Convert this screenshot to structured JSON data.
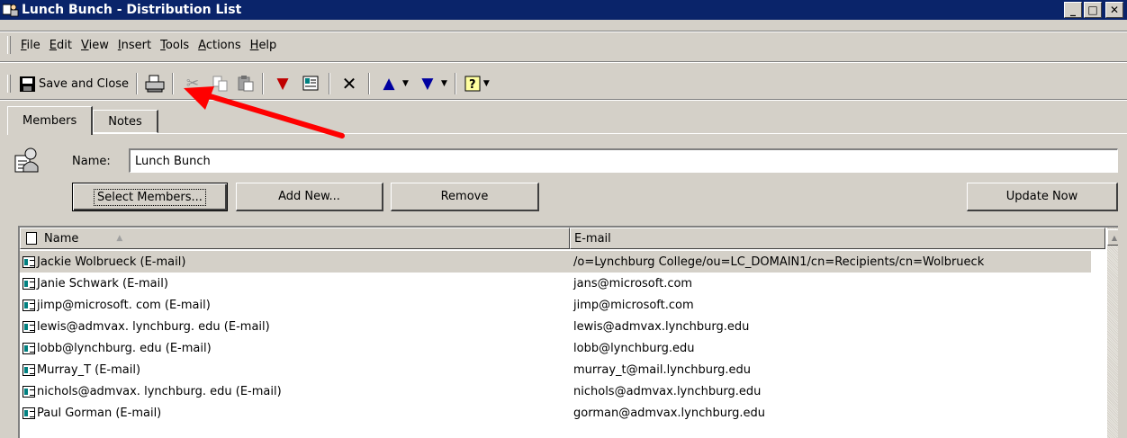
{
  "window": {
    "title": "Lunch Bunch - Distribution List",
    "controls": {
      "minimize": "_",
      "maximize": "□",
      "close": "✕"
    }
  },
  "menu": [
    "File",
    "Edit",
    "View",
    "Insert",
    "Tools",
    "Actions",
    "Help"
  ],
  "menu_underline": [
    "F",
    "E",
    "V",
    "I",
    "T",
    "A",
    "H"
  ],
  "toolbar": {
    "save_close_label": "Save and Close",
    "icons": [
      "print-icon",
      "cut-icon",
      "copy-icon",
      "paste-icon",
      "flag-icon",
      "address-book-icon",
      "delete-icon",
      "previous-item-icon",
      "next-item-icon",
      "help-icon"
    ]
  },
  "tabs": [
    {
      "label": "Members",
      "active": true
    },
    {
      "label": "Notes",
      "active": false
    }
  ],
  "name_field": {
    "label": "Name:",
    "value": "Lunch Bunch"
  },
  "buttons": {
    "select_members": "Select Members...",
    "add_new": "Add New...",
    "remove": "Remove",
    "update_now": "Update Now"
  },
  "list": {
    "columns": [
      "Name",
      "E-mail"
    ],
    "rows": [
      {
        "name": "Jackie Wolbrueck (E-mail)",
        "email": "/o=Lynchburg College/ou=LC_DOMAIN1/cn=Recipients/cn=Wolbrueck",
        "selected": true
      },
      {
        "name": "Janie Schwark (E-mail)",
        "email": "jans@microsoft.com"
      },
      {
        "name": "jimp@microsoft. com (E-mail)",
        "email": "jimp@microsoft.com"
      },
      {
        "name": "lewis@admvax. lynchburg. edu (E-mail)",
        "email": "lewis@admvax.lynchburg.edu"
      },
      {
        "name": "lobb@lynchburg. edu (E-mail)",
        "email": "lobb@lynchburg.edu"
      },
      {
        "name": "Murray_T (E-mail)",
        "email": "murray_t@mail.lynchburg.edu"
      },
      {
        "name": "nichols@admvax. lynchburg. edu (E-mail)",
        "email": "nichols@admvax.lynchburg.edu"
      },
      {
        "name": "Paul Gorman (E-mail)",
        "email": "gorman@admvax.lynchburg.edu"
      }
    ]
  },
  "colors": {
    "titlebar": "#0a246a",
    "face": "#d4d0c8",
    "annotation_arrow": "#ff0000"
  }
}
